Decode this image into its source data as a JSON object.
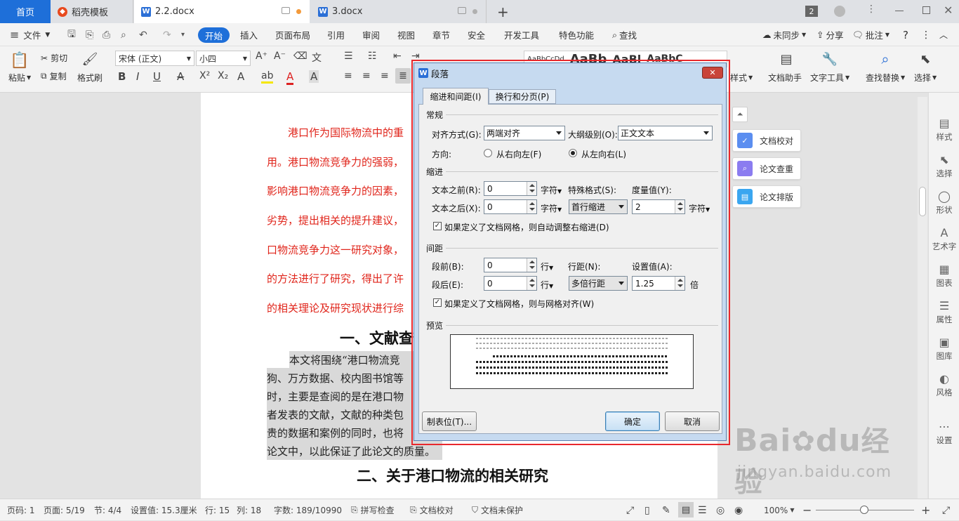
{
  "tabs": {
    "home": "首页",
    "template": "稻壳模板",
    "doc1": "2.2.docx",
    "doc2": "3.docx",
    "add": "+",
    "badge": "2"
  },
  "menu": {
    "hamburger": "≡",
    "file": "文件",
    "items": [
      "开始",
      "插入",
      "页面布局",
      "引用",
      "审阅",
      "视图",
      "章节",
      "安全",
      "开发工具",
      "特色功能"
    ],
    "search": "查找",
    "sync": "未同步",
    "share": "分享",
    "annotate": "批注",
    "help": "?"
  },
  "ribbon": {
    "paste": "粘贴",
    "cut": "剪切",
    "copy": "复制",
    "format_painter": "格式刷",
    "font_name": "宋体 (正文)",
    "font_size": "小四",
    "style_preview1": "AaBbCcDd",
    "style_preview2": "AaBb",
    "style_preview3": "AaBl",
    "style_preview4": "AaBbC",
    "styles": "样式",
    "doc_assistant": "文档助手",
    "text_tools": "文字工具",
    "find_replace": "查找替换",
    "select": "选择"
  },
  "document": {
    "red_lines": [
      "港口作为国际物流中的重",
      "用。港口物流竞争力的强弱，",
      "影响港口物流竞争力的因素，",
      "劣势，提出相关的提升建议，",
      "口物流竞争力这一研究对象，",
      "的方法进行了研究，得出了许",
      "的相关理论及研究现状进行综"
    ],
    "heading1": "一、文献查",
    "black_lines": [
      "本文将围绕“港口物流竞",
      "狗、万方数据、校内图书馆等",
      "时，主要是查阅的是在港口物",
      "者发表的文献，文献的种类包",
      "贵的数据和案例的同时，也将",
      "论文中，以此保证了此论文的质量。"
    ],
    "heading2": "二、关于港口物流的相关研究"
  },
  "float_panel": {
    "proofread": "文档校对",
    "check": "论文查重",
    "layout": "论文排版"
  },
  "right_sidebar": [
    "样式",
    "选择",
    "形状",
    "艺术字",
    "图表",
    "属性",
    "图库",
    "风格",
    "设置"
  ],
  "dialog": {
    "title": "段落",
    "tab_indent": "缩进和间距(I)",
    "tab_breaks": "换行和分页(P)",
    "general": "常规",
    "align_label": "对齐方式(G):",
    "align_value": "两端对齐",
    "outline_label": "大纲级别(O):",
    "outline_value": "正文文本",
    "direction_label": "方向:",
    "rtl": "从右向左(F)",
    "ltr": "从左向右(L)",
    "indent": "缩进",
    "before_text_label": "文本之前(R):",
    "before_text_value": "0",
    "after_text_label": "文本之后(X):",
    "after_text_value": "0",
    "unit_char": "字符",
    "special_label": "特殊格式(S):",
    "special_value": "首行缩进",
    "measure_label": "度量值(Y):",
    "measure_value": "2",
    "auto_adjust": "如果定义了文档网格，则自动调整右缩进(D)",
    "spacing": "间距",
    "before_label": "段前(B):",
    "before_value": "0",
    "after_label": "段后(E):",
    "after_value": "0",
    "unit_line": "行",
    "line_spacing_label": "行距(N):",
    "line_spacing_value": "多倍行距",
    "set_value_label": "设置值(A):",
    "set_value": "1.25",
    "unit_times": "倍",
    "grid_align": "如果定义了文档网格，则与网格对齐(W)",
    "preview": "预览",
    "tabs_button": "制表位(T)...",
    "ok": "确定",
    "cancel": "取消"
  },
  "status": {
    "page": "页码: 1",
    "pages": "页面: 5/19",
    "section": "节: 4/4",
    "setting": "设置值: 15.3厘米",
    "row": "行: 15",
    "col": "列: 18",
    "words": "字数: 189/10990",
    "spell": "拼写检查",
    "proof": "文档校对",
    "protect": "文档未保护",
    "zoom": "100%"
  },
  "watermark": {
    "brand": "Bai",
    "brand2": "du",
    "cn": "经验",
    "url": "jingyan.baidu.com"
  },
  "colors": {
    "accent": "#1e6fd9",
    "doc_red": "#e0251b",
    "highlight_frame": "#e8282d"
  }
}
